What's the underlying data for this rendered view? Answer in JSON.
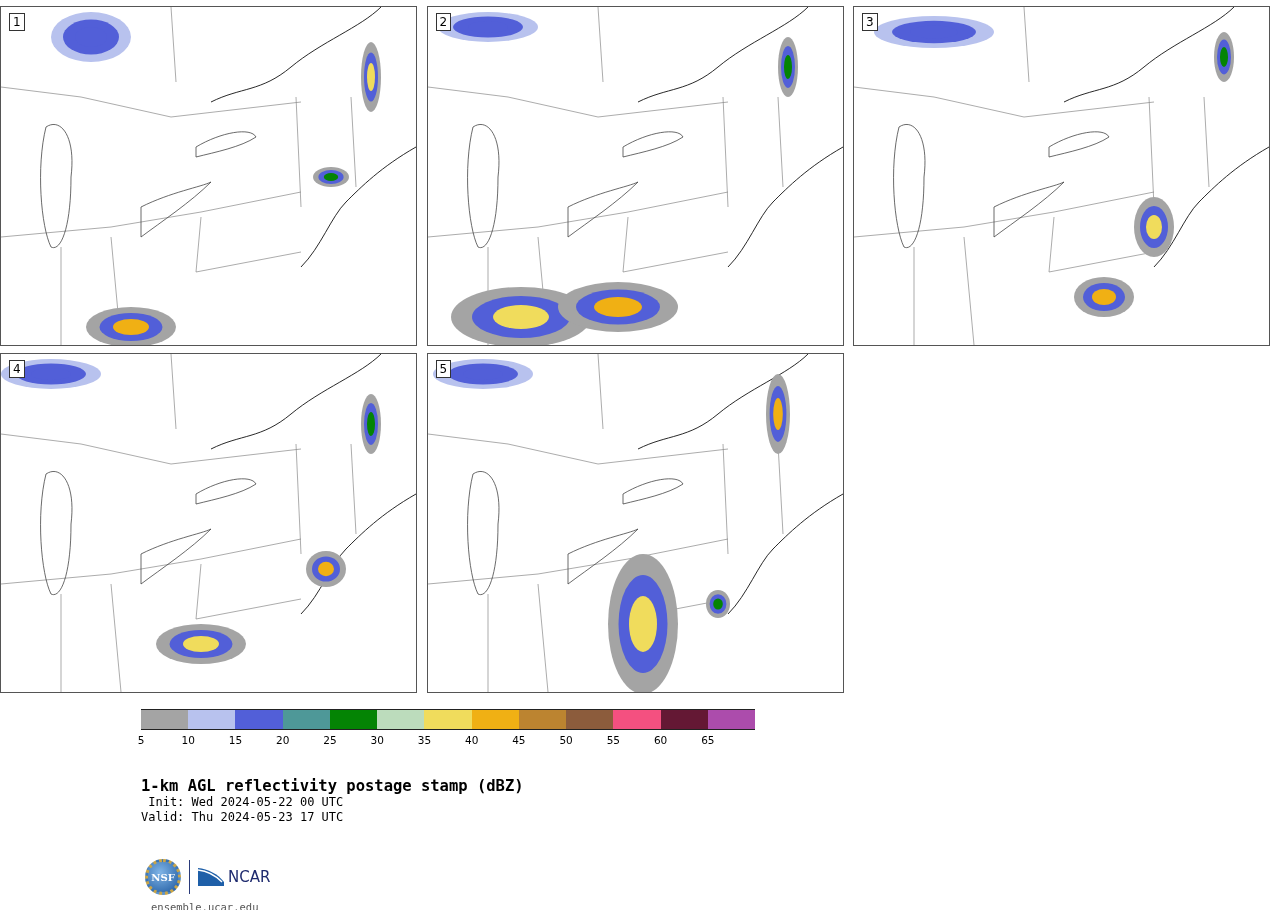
{
  "panels": [
    {
      "number": "1"
    },
    {
      "number": "2"
    },
    {
      "number": "3"
    },
    {
      "number": "4"
    },
    {
      "number": "5"
    }
  ],
  "colorbar": {
    "bins": [
      {
        "color": "#a4a4a4",
        "tick": "5"
      },
      {
        "color": "#b8c2ee",
        "tick": "10"
      },
      {
        "color": "#525fd8",
        "tick": "15"
      },
      {
        "color": "#4e9898",
        "tick": "20"
      },
      {
        "color": "#048404",
        "tick": "25"
      },
      {
        "color": "#bcdcbc",
        "tick": "30"
      },
      {
        "color": "#f0dc5c",
        "tick": "35"
      },
      {
        "color": "#f0b014",
        "tick": "40"
      },
      {
        "color": "#bc8430",
        "tick": "45"
      },
      {
        "color": "#8c5c3c",
        "tick": "50"
      },
      {
        "color": "#f45080",
        "tick": "55"
      },
      {
        "color": "#641834",
        "tick": "60"
      },
      {
        "color": "#ac4cac",
        "tick": "65"
      }
    ]
  },
  "title": "1-km AGL reflectivity postage stamp (dBZ)",
  "init": " Init: Wed 2024-05-22 00 UTC",
  "valid": "Valid: Thu 2024-05-23 17 UTC",
  "logos": {
    "left": "NSF",
    "right": "NCAR"
  },
  "footer": "ensemble.ucar.edu"
}
